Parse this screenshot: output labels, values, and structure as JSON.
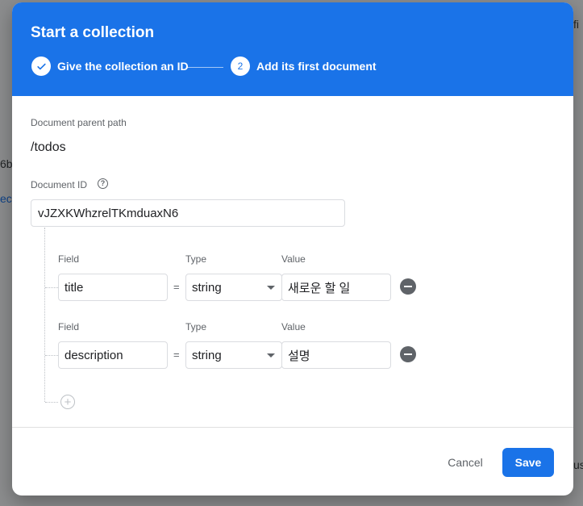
{
  "background": {
    "fragments": [
      "fi",
      "6b",
      "ect",
      "us"
    ]
  },
  "dialog": {
    "title": "Start a collection",
    "steps": [
      {
        "number": "✓",
        "label": "Give the collection an ID"
      },
      {
        "number": "2",
        "label": "Add its first document"
      }
    ],
    "parent_path_label": "Document parent path",
    "parent_path": "/todos",
    "document_id_label": "Document ID",
    "document_id_value": "vJZXKWhzrelTKmduaxN6",
    "fields": [
      {
        "field_label": "Field",
        "type_label": "Type",
        "value_label": "Value",
        "field": "title",
        "equals": "=",
        "type": "string",
        "value": "새로운 할 일"
      },
      {
        "field_label": "Field",
        "type_label": "Type",
        "value_label": "Value",
        "field": "description",
        "equals": "=",
        "type": "string",
        "value": "설명"
      }
    ],
    "cancel_label": "Cancel",
    "save_label": "Save"
  },
  "colors": {
    "accent": "#1a73e8",
    "icon": "#5f6368"
  },
  "icons": [
    "check-icon",
    "help-icon",
    "remove-field-icon",
    "add-field-icon",
    "dropdown-arrow-icon"
  ]
}
